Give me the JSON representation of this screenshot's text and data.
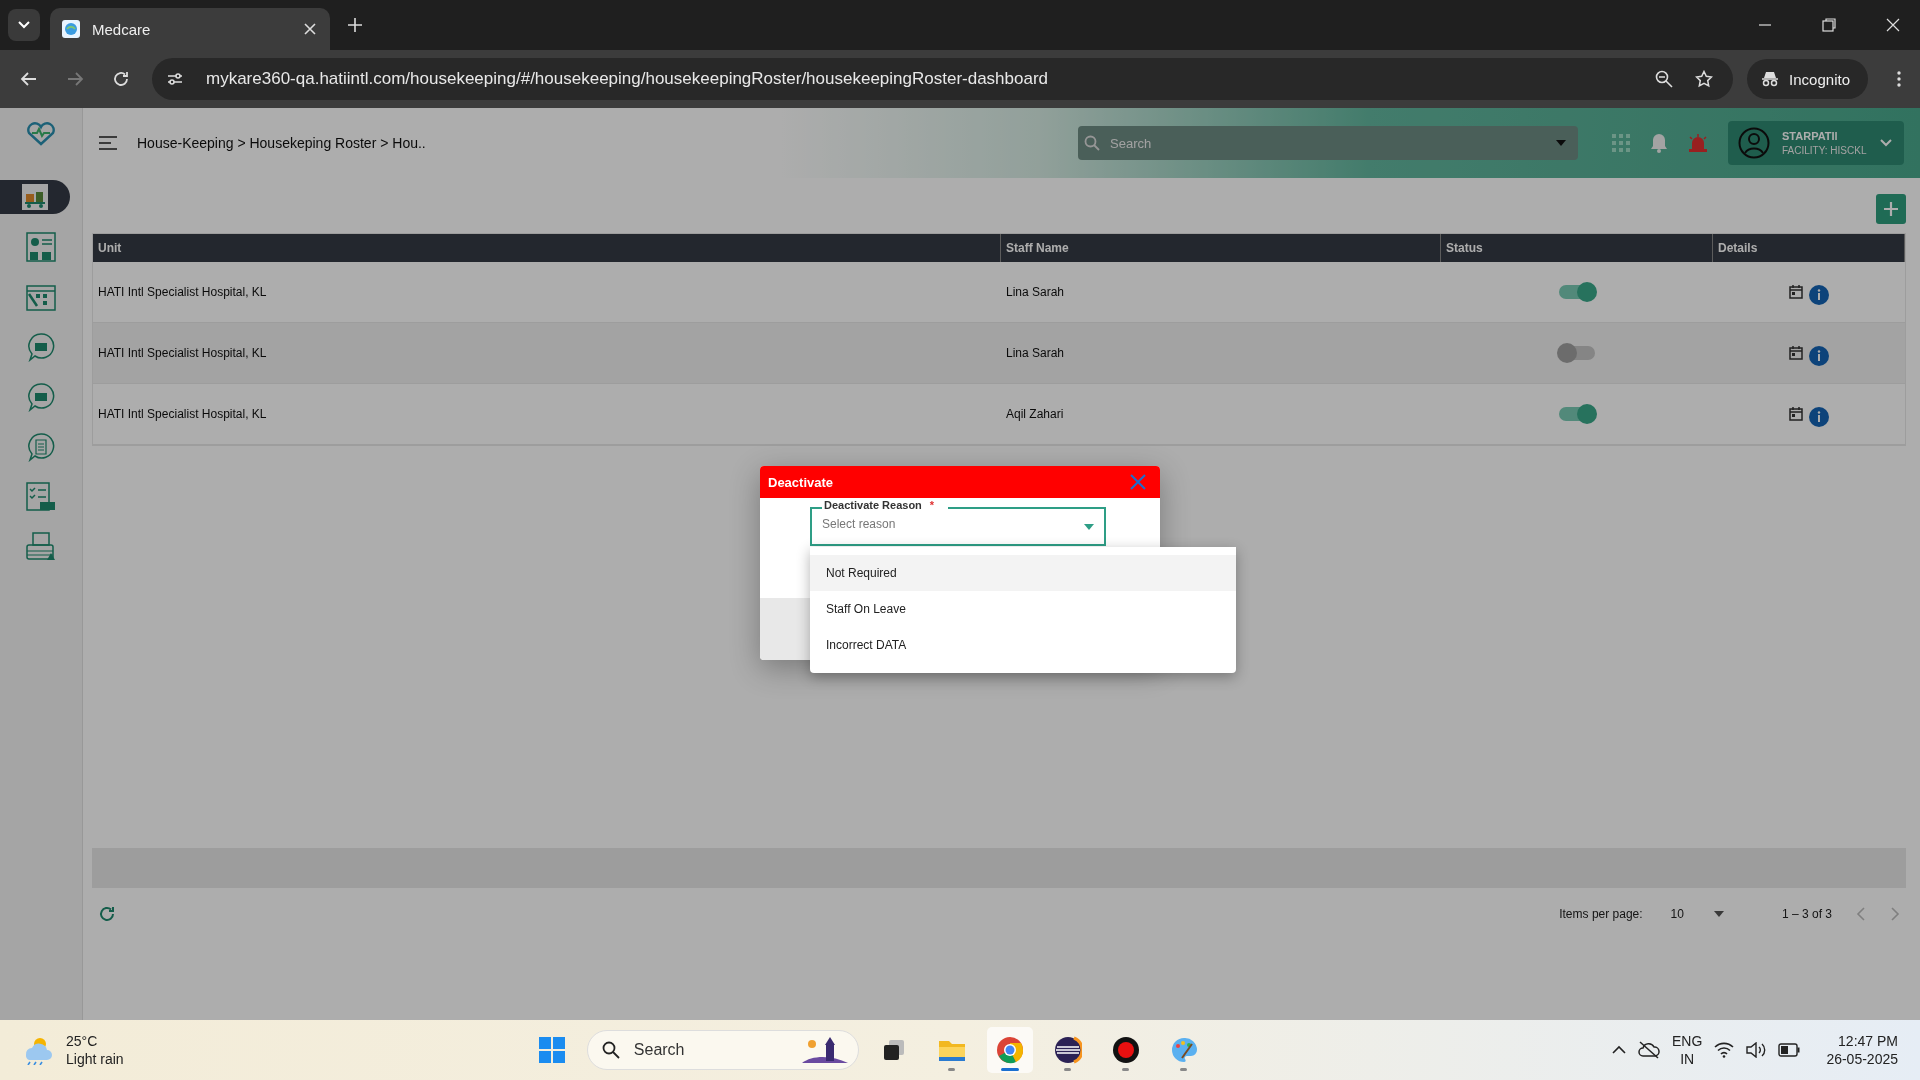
{
  "browser": {
    "tabs": [
      {
        "title": "Medcare",
        "selected": true
      }
    ],
    "url": "mykare360-qa.hatiintl.com/housekeeping/#/housekeeping/housekeepingRoster/housekeepingRoster-dashboard",
    "profile": "Incognito"
  },
  "sidebar": {
    "items": [
      {
        "kind": "cart",
        "selected": true
      },
      {
        "kind": "dashboard",
        "selected": false
      },
      {
        "kind": "calendar",
        "selected": false
      },
      {
        "kind": "chat-cart",
        "selected": false
      },
      {
        "kind": "chat-chart",
        "selected": false
      },
      {
        "kind": "chat-list",
        "selected": false
      },
      {
        "kind": "checklist",
        "selected": false
      },
      {
        "kind": "printer",
        "selected": false
      }
    ]
  },
  "header": {
    "breadcrumb": "House-Keeping > Housekeping Roster > Hou..",
    "search": {
      "placeholder": "Search"
    },
    "user": {
      "name": "STARPATIl",
      "facility": "FACILITY: HISCKL"
    }
  },
  "table": {
    "columns": [
      "Unit",
      "Staff Name",
      "Status",
      "Details"
    ],
    "rows": [
      {
        "unit": "HATI Intl Specialist Hospital, KL",
        "staff": "Lina Sarah",
        "on": true
      },
      {
        "unit": "HATI Intl Specialist Hospital, KL",
        "staff": "Lina Sarah",
        "on": false
      },
      {
        "unit": "HATI Intl Specialist Hospital, KL",
        "staff": "Aqil Zahari",
        "on": true
      }
    ]
  },
  "pager": {
    "label": "Items per page:",
    "size": "10",
    "range": "1 – 3 of 3"
  },
  "dialog": {
    "title": "Deactivate",
    "field": {
      "label": "Deactivate Reason",
      "required": "*",
      "placeholder": "Select reason"
    },
    "options": [
      {
        "label": "Not Required",
        "active": true
      },
      {
        "label": "Staff On Leave",
        "active": false
      },
      {
        "label": "Incorrect DATA",
        "active": false
      }
    ]
  },
  "taskbar": {
    "weather": {
      "temp": "25°C",
      "condition": "Light rain"
    },
    "search": {
      "placeholder": "Search"
    },
    "apps": [
      {
        "kind": "start",
        "running": false,
        "active": false
      },
      {
        "kind": "task-view",
        "running": false,
        "active": false
      },
      {
        "kind": "folder",
        "running": true,
        "active": false
      },
      {
        "kind": "chrome",
        "running": true,
        "active": true
      },
      {
        "kind": "eclipse",
        "running": true,
        "active": false
      },
      {
        "kind": "recorder",
        "running": true,
        "active": false
      },
      {
        "kind": "paint",
        "running": true,
        "active": false
      }
    ],
    "language": "ENG",
    "region": "IN",
    "time": "12:47 PM",
    "date": "26-05-2025"
  }
}
